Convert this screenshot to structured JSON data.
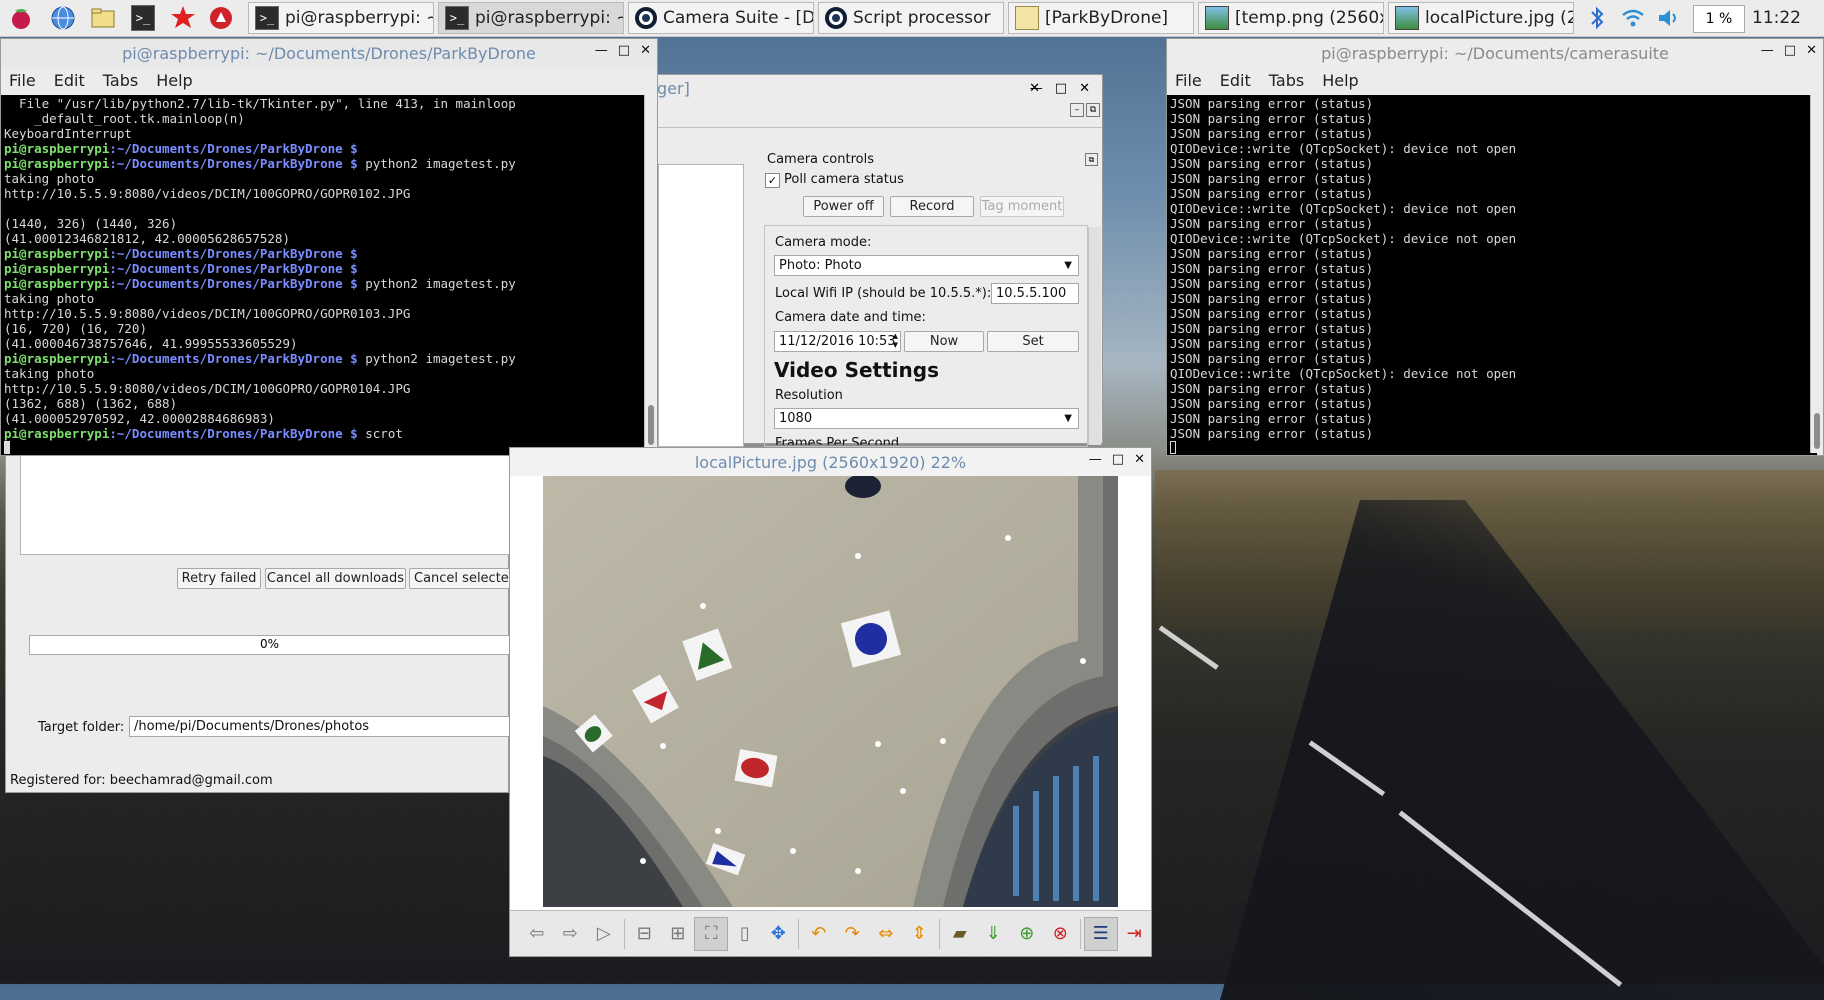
{
  "taskbar": {
    "launchers": [
      "raspberry-icon",
      "globe-icon",
      "file-manager-icon",
      "terminal-icon",
      "mathematica-icon",
      "wolfram-icon"
    ],
    "tasks": [
      {
        "label": "pi@raspberrypi: ~/...",
        "icon": "terminal"
      },
      {
        "label": "pi@raspberrypi: ~/...",
        "icon": "terminal"
      },
      {
        "label": "Camera Suite - [Do...",
        "icon": "camera"
      },
      {
        "label": "Script processor",
        "icon": "camera"
      },
      {
        "label": "[ParkByDrone]",
        "icon": "folder"
      },
      {
        "label": "[temp.png (2560x1...",
        "icon": "image"
      },
      {
        "label": "localPicture.jpg (25...",
        "icon": "image"
      }
    ],
    "cpu": "1 %",
    "clock": "11:22"
  },
  "terminal_left": {
    "title": "pi@raspberrypi: ~/Documents/Drones/ParkByDrone",
    "menu": [
      "File",
      "Edit",
      "Tabs",
      "Help"
    ],
    "prompt_user": "pi@raspberrypi",
    "prompt_path": ":~/Documents/Drones/ParkByDrone $",
    "lines": [
      {
        "type": "out",
        "text": "  File \"/usr/lib/python2.7/lib-tk/Tkinter.py\", line 413, in mainloop"
      },
      {
        "type": "out",
        "text": "    _default_root.tk.mainloop(n)"
      },
      {
        "type": "out",
        "text": "KeyboardInterrupt"
      },
      {
        "type": "prompt",
        "text": ""
      },
      {
        "type": "prompt",
        "text": " python2 imagetest.py"
      },
      {
        "type": "out",
        "text": "taking photo"
      },
      {
        "type": "out",
        "text": "http://10.5.5.9:8080/videos/DCIM/100GOPRO/GOPR0102.JPG"
      },
      {
        "type": "out",
        "text": ""
      },
      {
        "type": "out",
        "text": "(1440, 326) (1440, 326)"
      },
      {
        "type": "out",
        "text": "(41.00012346821812, 42.00005628657528)"
      },
      {
        "type": "prompt",
        "text": ""
      },
      {
        "type": "prompt",
        "text": ""
      },
      {
        "type": "prompt",
        "text": " python2 imagetest.py"
      },
      {
        "type": "out",
        "text": "taking photo"
      },
      {
        "type": "out",
        "text": "http://10.5.5.9:8080/videos/DCIM/100GOPRO/GOPR0103.JPG"
      },
      {
        "type": "out",
        "text": "(16, 720) (16, 720)"
      },
      {
        "type": "out",
        "text": "(41.000046738757646, 41.99955533605529)"
      },
      {
        "type": "prompt",
        "text": " python2 imagetest.py"
      },
      {
        "type": "out",
        "text": "taking photo"
      },
      {
        "type": "out",
        "text": "http://10.5.5.9:8080/videos/DCIM/100GOPRO/GOPR0104.JPG"
      },
      {
        "type": "out",
        "text": "(1362, 688) (1362, 688)"
      },
      {
        "type": "out",
        "text": "(41.000052970592, 42.00002884686983)"
      },
      {
        "type": "prompt",
        "text": " scrot"
      }
    ]
  },
  "terminal_right": {
    "title": "pi@raspberrypi: ~/Documents/camerasuite",
    "menu": [
      "File",
      "Edit",
      "Tabs",
      "Help"
    ],
    "lines": [
      "JSON parsing error (status)",
      "JSON parsing error (status)",
      "JSON parsing error (status)",
      "QIODevice::write (QTcpSocket): device not open",
      "JSON parsing error (status)",
      "JSON parsing error (status)",
      "JSON parsing error (status)",
      "QIODevice::write (QTcpSocket): device not open",
      "JSON parsing error (status)",
      "QIODevice::write (QTcpSocket): device not open",
      "JSON parsing error (status)",
      "JSON parsing error (status)",
      "JSON parsing error (status)",
      "JSON parsing error (status)",
      "JSON parsing error (status)",
      "JSON parsing error (status)",
      "JSON parsing error (status)",
      "JSON parsing error (status)",
      "QIODevice::write (QTcpSocket): device not open",
      "JSON parsing error (status)",
      "JSON parsing error (status)",
      "JSON parsing error (status)",
      "JSON parsing error (status)"
    ]
  },
  "camera_suite": {
    "title_fragment": "ger]",
    "camera_controls": "Camera controls",
    "poll_status": "Poll camera status",
    "poll_checked": true,
    "power_off": "Power off",
    "record": "Record",
    "tag_moment": "Tag moment",
    "camera_mode_label": "Camera mode:",
    "camera_mode_value": "Photo: Photo",
    "wifi_label": "Local Wifi IP (should be 10.5.5.*):",
    "wifi_value": "10.5.5.100",
    "datetime_label": "Camera date and time:",
    "datetime_value": "11/12/2016 10:53",
    "now": "Now",
    "set": "Set",
    "video_settings": "Video Settings",
    "resolution_label": "Resolution",
    "resolution_value": "1080",
    "fps_label": "Frames Per Second"
  },
  "download_manager": {
    "retry_failed": "Retry failed",
    "cancel_all": "Cancel all downloads",
    "cancel_selected": "Cancel selected",
    "progress_text": "0%",
    "progress_fraction": 0,
    "target_label": "Target folder:",
    "target_value": "/home/pi/Documents/Drones/photos",
    "registered": "Registered for: beechamrad@gmail.com"
  },
  "image_viewer": {
    "title": "localPicture.jpg (2560x1920) 22%",
    "toolbar": [
      "prev-icon",
      "next-icon",
      "play-icon",
      "zoom-out-icon",
      "zoom-in-icon",
      "fit-icon",
      "original-size-icon",
      "fullscreen-icon",
      "rotate-left-icon",
      "rotate-right-icon",
      "flip-horizontal-icon",
      "flip-vertical-icon",
      "open-icon",
      "save-icon",
      "save-as-icon",
      "delete-icon",
      "preferences-icon",
      "quit-icon"
    ]
  }
}
